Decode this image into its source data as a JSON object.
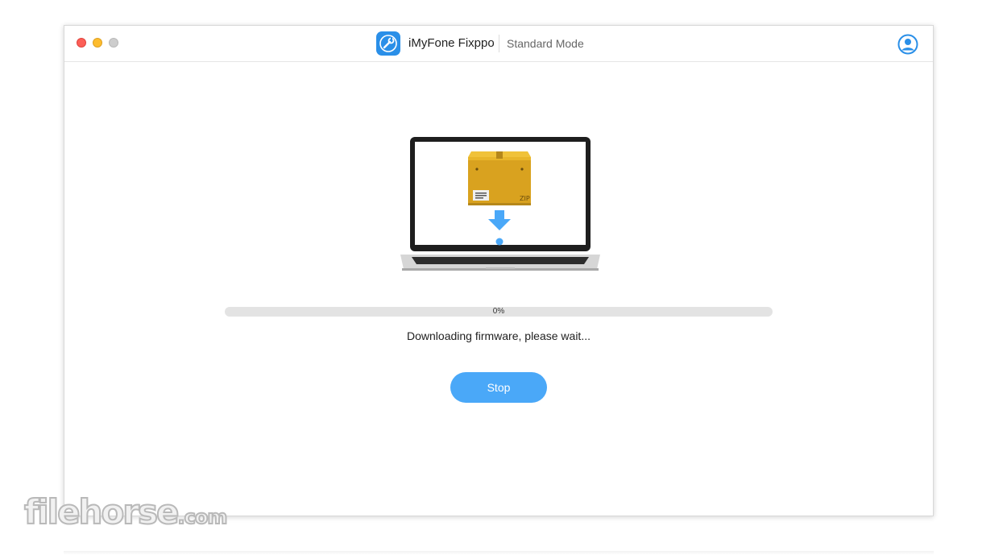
{
  "window": {
    "app_name": "iMyFone Fixppo",
    "mode": "Standard Mode"
  },
  "illustration": {
    "zip_label": "ZIP"
  },
  "progress": {
    "value": 0,
    "label": "0%"
  },
  "status": {
    "message": "Downloading firmware, please wait..."
  },
  "actions": {
    "stop_label": "Stop"
  },
  "watermark": {
    "brand": "filehorse",
    "suffix": ".com"
  },
  "colors": {
    "accent": "#4aa8f8",
    "track": "#e3e3e3",
    "traffic_close": "#fc5f57",
    "traffic_minimize": "#fdbc2e",
    "traffic_zoom": "#cdcdcd",
    "box": "#d9a21f"
  },
  "icons": {
    "app": "wrench-app-icon",
    "account": "user-account-icon",
    "download": "download-arrow-icon",
    "archive": "zip-box-icon"
  }
}
